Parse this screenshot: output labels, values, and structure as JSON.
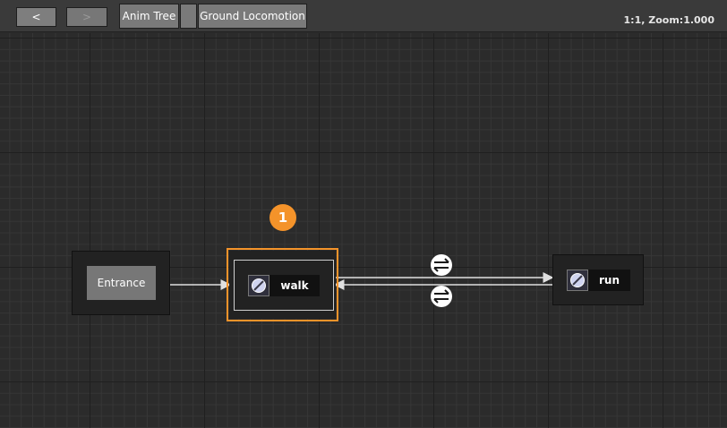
{
  "toolbar": {
    "back_label": "<",
    "forward_label": ">",
    "breadcrumbs": [
      "Anim Tree",
      "",
      "Ground Locomotion"
    ],
    "zoom_text": "1:1, Zoom:1.000"
  },
  "graph": {
    "entrance_label": "Entrance",
    "states": [
      {
        "label": "walk",
        "icon": "state-machine-icon"
      },
      {
        "label": "run",
        "icon": "state-machine-icon"
      }
    ],
    "annotation_badge": "1",
    "transition_icons": [
      "transition-swap-icon",
      "transition-swap-icon"
    ]
  },
  "colors": {
    "highlight": "#f4932a",
    "canvas_bg": "#2b2b2b",
    "node_bg": "#222222",
    "arrow": "#e0e0e0"
  }
}
